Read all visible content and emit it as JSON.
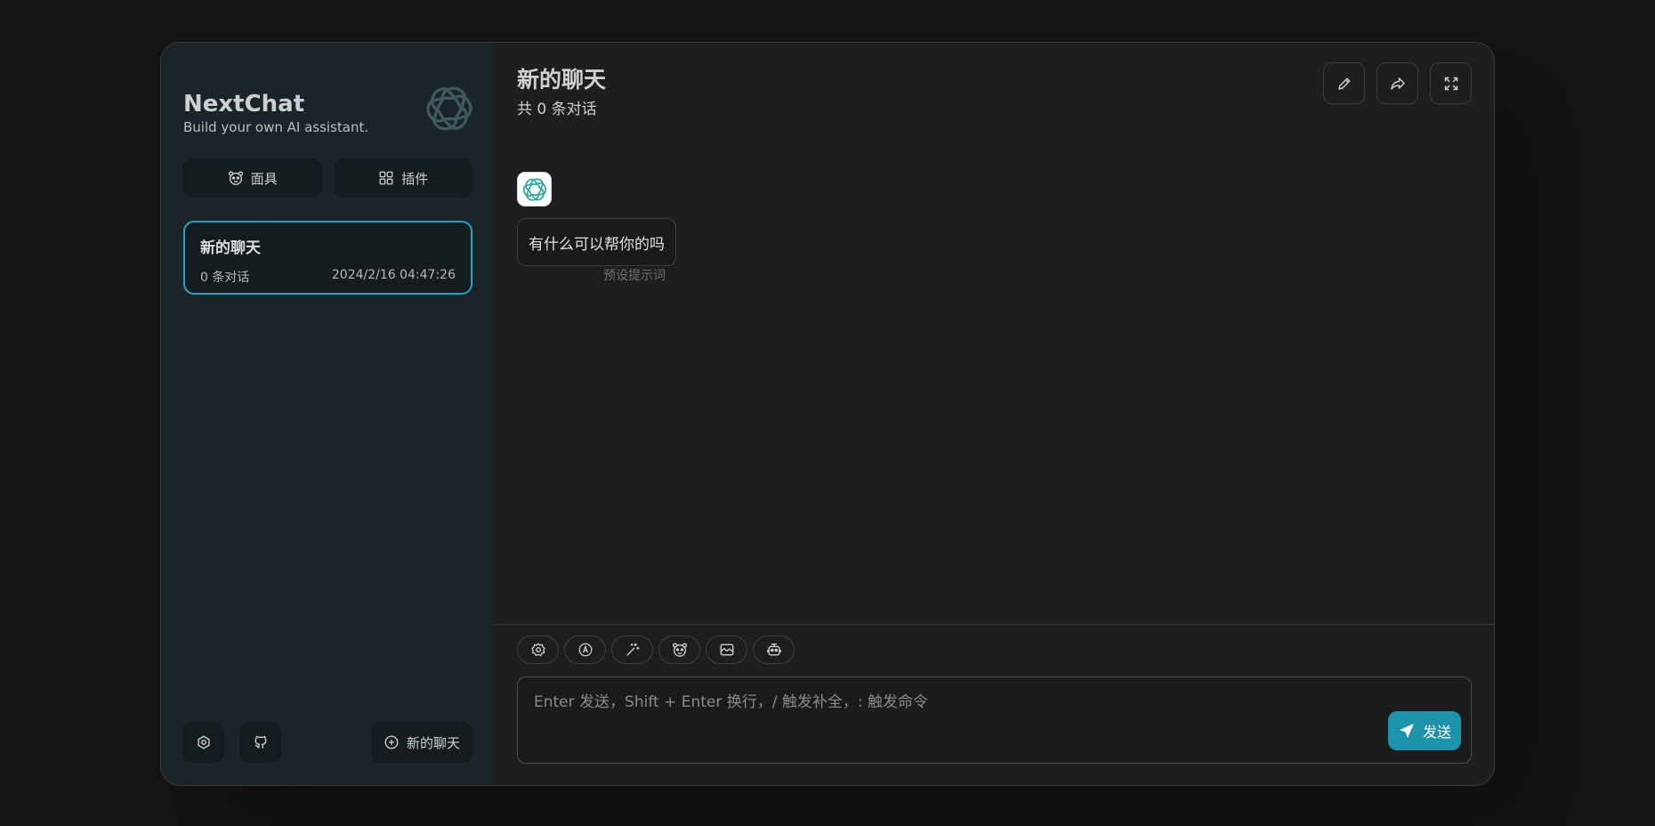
{
  "sidebar": {
    "brand_title": "NextChat",
    "brand_subtitle": "Build your own AI assistant.",
    "mask_button": "面具",
    "plugin_button": "插件",
    "chat_list": [
      {
        "title": "新的聊天",
        "count": "0 条对话",
        "time": "2024/2/16 04:47:26"
      }
    ],
    "new_chat_button": "新的聊天"
  },
  "main": {
    "title": "新的聊天",
    "subtitle": "共 0 条对话",
    "message_text": "有什么可以帮你的吗",
    "message_note": "预设提示词",
    "input_placeholder": "Enter 发送，Shift + Enter 换行，/ 触发补全，: 触发命令",
    "send_label": "发送"
  },
  "colors": {
    "accent": "#1d93ab",
    "selected_border": "#1fa5c9",
    "sidebar_bg": "#1b2529"
  },
  "icons": {
    "sidebar": [
      "openai-logo-icon",
      "mask-icon",
      "plugin-grid-icon",
      "settings-icon",
      "github-icon",
      "add-circle-icon"
    ],
    "header": [
      "edit-icon",
      "share-icon",
      "fullscreen-icon"
    ],
    "tools": [
      "settings-icon",
      "auto-theme-icon",
      "prompt-magic-icon",
      "mask-icon",
      "image-icon",
      "robot-icon"
    ],
    "send": "send-icon"
  }
}
